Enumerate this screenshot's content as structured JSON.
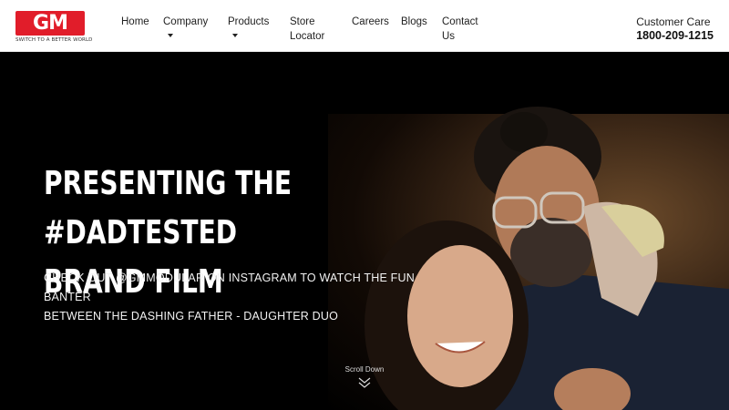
{
  "brand": {
    "logo_text": "GM",
    "tagline": "SWITCH TO A BETTER WORLD",
    "logo_color": "#e11d2a"
  },
  "nav": {
    "home": "Home",
    "company": "Company",
    "products": "Products",
    "store_locator_line1": "Store",
    "store_locator_line2": "Locator",
    "careers": "Careers",
    "blogs": "Blogs",
    "contact_line1": "Contact",
    "contact_line2": "Us"
  },
  "customer_care": {
    "label": "Customer Care",
    "phone": "1800-209-1215"
  },
  "hero": {
    "title_line1": "PRESENTING THE #DADTESTED",
    "title_line2": "BRAND FILM",
    "subtitle_line1": "CHECK OUT @GMMODULAR ON INSTAGRAM TO WATCH THE FUN BANTER",
    "subtitle_line2": "BETWEEN THE DASHING FATHER - DAUGHTER DUO",
    "scroll_label": "Scroll Down"
  }
}
